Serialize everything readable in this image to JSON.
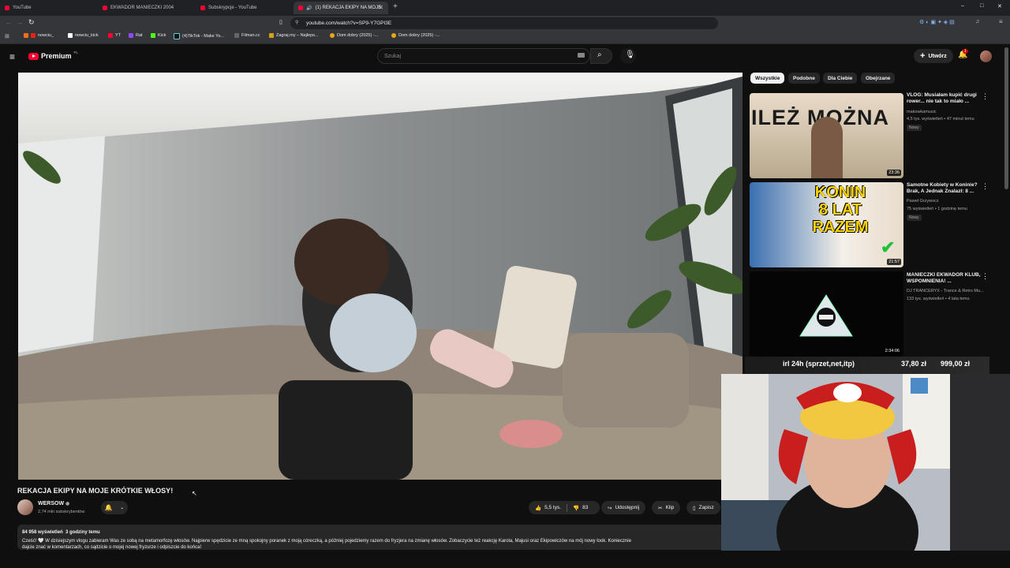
{
  "browser": {
    "tabs": [
      {
        "label": "YouTube"
      },
      {
        "label": "EKWADOR MANIECZKI 2004"
      },
      {
        "label": "Subskrypcje - YouTube"
      },
      {
        "label": "(1) REKACJA EKIPY NA MOJE"
      }
    ],
    "url": "youtube.com/watch?v=SP9-Y7GPI3E",
    "bookmarks": [
      "nowciu_",
      "nowciu_kick",
      "YT",
      "Rat",
      "Kick",
      "(4)TikTok - Make Yo...",
      "Filman.cc",
      "Zagraj.my – Najleps...",
      "Dom dobry (2025) -...",
      "Dom dobry (2025) -..."
    ],
    "window_controls": [
      "–",
      "□",
      "✕"
    ]
  },
  "youtube": {
    "logo": "Premium",
    "logo_region": "PL",
    "search_placeholder": "Szukaj",
    "create_label": "Utwórz",
    "notif_count": "1"
  },
  "video": {
    "title": "REKACJA EKIPY NA MOJE KRÓTKIE WŁOSY!",
    "channel": "WERSOW",
    "subscribers": "2,74 mln subskrybentów",
    "likes": "5,5 tys.",
    "dislikes": "83",
    "share_label": "Udostępnij",
    "clip_label": "Klip",
    "save_label": "Zapisz",
    "views": "84 958 wyświetleń",
    "time": "3 godziny temu",
    "description": "Cześć! 🤍 W dzisiejszym vlogu zabieram Was ze sobą na metamorfozę włosów. Najpierw spędzicie ze mną spokojny poranek z moją córeczką, a później pojedziemy razem do fryzjera na zmianę włosów. Zobaczycie też reakcję Karola, Majusi oraz Ekipowiczów na mój nowy look. Koniecznie",
    "description_line2": "dajcie znać w komentarzach, co sądzicie o mojej nowej fryzurze i odpiszcie do końca!"
  },
  "chips": [
    "Wszystkie",
    "Podobne",
    "Dla Ciebie",
    "Obejrzane"
  ],
  "recommendations": [
    {
      "title": "VLOG: Musiałam kupić drugi rower... nie tak to miało ...",
      "channel": "makowkamusic",
      "meta": "4,5 tys. wyświetleń • 47 minut temu",
      "badge": "Nowy",
      "duration": "23:36",
      "thumb_text": "ILEŻ MOŻNA"
    },
    {
      "title": "Samotne Kobiety w Koninie? Brak, A Jednak Znalazł: 8 ...",
      "channel": "Paweł Grzywocz",
      "meta": "75 wyświetleń • 1 godzinę temu",
      "badge": "Nowy",
      "duration": "21:57",
      "thumb_line1": "KONIN",
      "thumb_line2": "8 LAT",
      "thumb_line3": "RAZEM"
    },
    {
      "title": "MANIECZKI EKWADOR KLUB, WSPOMNIENIA! ...",
      "channel": "DJ TRANCERYX - Trance & Retro Mu...",
      "meta": "133 tys. wyświetleń • 4 lata temu",
      "duration": "2:34:06"
    }
  ],
  "overlay": {
    "left_text": "irl 24h (sprzet,net,itp)",
    "price1": "37,80 zł",
    "price2": "999,00 zł"
  },
  "colors": {
    "youtube_red": "#ff0033",
    "background": "#0f0f0f",
    "chip_active": "#f1f1f1"
  }
}
